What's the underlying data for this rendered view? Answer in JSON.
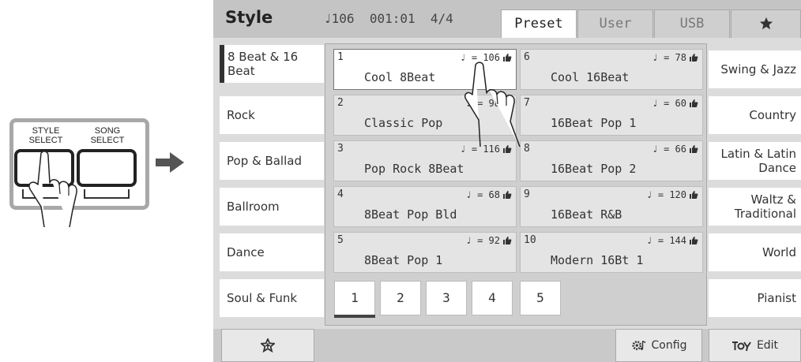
{
  "panel": {
    "buttons": [
      {
        "label_line1": "STYLE",
        "label_line2": "SELECT"
      },
      {
        "label_line1": "SONG",
        "label_line2": "SELECT"
      }
    ]
  },
  "header": {
    "title": "Style",
    "tempo": "106",
    "measure": "001:01",
    "time_signature": "4/4",
    "tabs": [
      {
        "label": "Preset",
        "active": true
      },
      {
        "label": "User"
      },
      {
        "label": "USB"
      },
      {
        "label": "",
        "icon": "star-icon"
      }
    ]
  },
  "categories_left": [
    {
      "label": "8 Beat & 16 Beat",
      "selected": true
    },
    {
      "label": "Rock"
    },
    {
      "label": "Pop & Ballad"
    },
    {
      "label": "Ballroom"
    },
    {
      "label": "Dance"
    },
    {
      "label": "Soul & Funk"
    }
  ],
  "categories_right": [
    {
      "label": "Swing & Jazz"
    },
    {
      "label": "Country"
    },
    {
      "label": "Latin & Latin Dance"
    },
    {
      "label": "Waltz & Traditional"
    },
    {
      "label": "World"
    },
    {
      "label": "Pianist"
    }
  ],
  "styles": [
    {
      "num": "1",
      "tempo": "= 106",
      "name": "Cool 8Beat",
      "selected": true
    },
    {
      "num": "2",
      "tempo": "= 98",
      "name": "Classic Pop"
    },
    {
      "num": "3",
      "tempo": "= 116",
      "name": "Pop Rock 8Beat"
    },
    {
      "num": "4",
      "tempo": "= 68",
      "name": "8Beat Pop Bld"
    },
    {
      "num": "5",
      "tempo": "= 92",
      "name": "8Beat Pop 1"
    },
    {
      "num": "6",
      "tempo": "= 78",
      "name": "Cool 16Beat"
    },
    {
      "num": "7",
      "tempo": "= 60",
      "name": "16Beat Pop 1"
    },
    {
      "num": "8",
      "tempo": "= 66",
      "name": "16Beat Pop 2"
    },
    {
      "num": "9",
      "tempo": "= 120",
      "name": "16Beat R&B"
    },
    {
      "num": "10",
      "tempo": "= 144",
      "name": "Modern 16Bt 1"
    }
  ],
  "pages": [
    "1",
    "2",
    "3",
    "4",
    "5"
  ],
  "current_page": "1",
  "bottom": {
    "config_label": "Config",
    "edit_label": "Edit"
  }
}
